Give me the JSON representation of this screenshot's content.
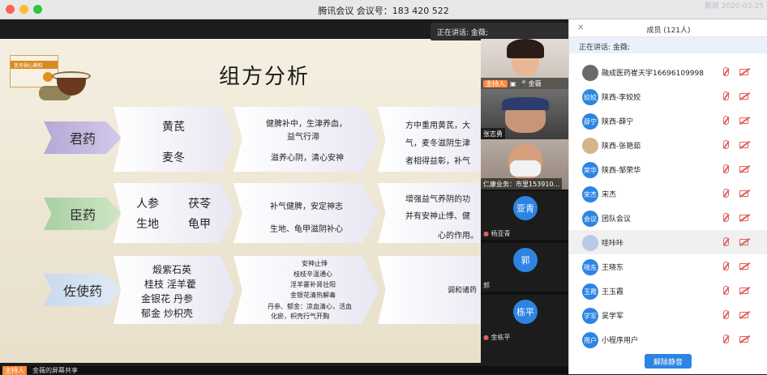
{
  "window": {
    "title": "腾讯会议 会议号：183 420 522",
    "date": "截屏 2020-03-25",
    "traffic_colors": [
      "#ff5f57",
      "#febc2e",
      "#28c840"
    ]
  },
  "speaking_float": "正在讲话: 金薇;",
  "slide": {
    "title": "组方分析",
    "product_label": "芪冬颐心颗粒",
    "rows": [
      {
        "label": "君药",
        "herbs": [
          "黄芪",
          "麦冬"
        ],
        "effects": [
          "健脾补中，生津养血，",
          "益气行滞",
          "滋养心阴，清心安神"
        ],
        "desc": [
          "方中重用黄芪，大",
          "气，麦冬滋阴生津",
          "者相得益彰，补气"
        ]
      },
      {
        "label": "臣药",
        "herbs": [
          "人参",
          "茯苓",
          "生地",
          "龟甲"
        ],
        "effects": [
          "补气健脾，安定神志",
          "生地、龟甲滋阴补心"
        ],
        "desc": [
          "增强益气养阴的功",
          "并有安神止悸、健",
          "心的作用。"
        ]
      },
      {
        "label": "佐使药",
        "herbs": [
          "煅紫石英",
          "桂枝 淫羊藿",
          "金银花 丹参",
          "郁金 炒枳壳"
        ],
        "effects": [
          "安神止悸",
          "桂枝辛温通心",
          "淫羊藿补肾壮阳",
          "金银花清热解毒",
          "丹参、郁金：凉血清心，活血",
          "化瘀，枳壳行气开胸"
        ],
        "desc": [
          "调和诸药"
        ]
      }
    ]
  },
  "videos": [
    {
      "name": "金薇",
      "host_badge": "主持人"
    },
    {
      "name": "张志勇"
    },
    {
      "name": "仁康业务：市里153910..."
    },
    {
      "name": "杨亚青",
      "avatar": "亚青"
    },
    {
      "name": "郭",
      "avatar": "郭"
    },
    {
      "name": "金栋平",
      "avatar": "栋平"
    }
  ],
  "bottombar": {
    "host": "主持人",
    "share": "金薇的屏幕共享"
  },
  "panel": {
    "header": "成员 (121人)",
    "speaking": "正在讲话: 金薇;",
    "members": [
      {
        "avatar": "",
        "name": "融成医药崔天宇16696109998",
        "color": "#6a6a6a"
      },
      {
        "avatar": "姣姣",
        "name": "陕西-李姣姣",
        "color": "#2d84e3"
      },
      {
        "avatar": "薛宁",
        "name": "陕西-薛宁",
        "color": "#2d84e3"
      },
      {
        "avatar": "",
        "name": "陕西-张艳茹",
        "color": "#d7b58a"
      },
      {
        "avatar": "荣华",
        "name": "陕西-邹荣华",
        "color": "#2d84e3"
      },
      {
        "avatar": "宋杰",
        "name": "宋杰",
        "color": "#2d84e3"
      },
      {
        "avatar": "会议",
        "name": "团队会议",
        "color": "#2d84e3"
      },
      {
        "avatar": "",
        "name": "哇咔咔",
        "color": "#b9c9e6"
      },
      {
        "avatar": "晓东",
        "name": "王晓东",
        "color": "#2d84e3"
      },
      {
        "avatar": "玉霞",
        "name": "王玉霞",
        "color": "#2d84e3"
      },
      {
        "avatar": "学军",
        "name": "吴学军",
        "color": "#2d84e3"
      },
      {
        "avatar": "用户",
        "name": "小程序用户",
        "color": "#2d84e3"
      }
    ],
    "unmute_label": "解除静音"
  }
}
